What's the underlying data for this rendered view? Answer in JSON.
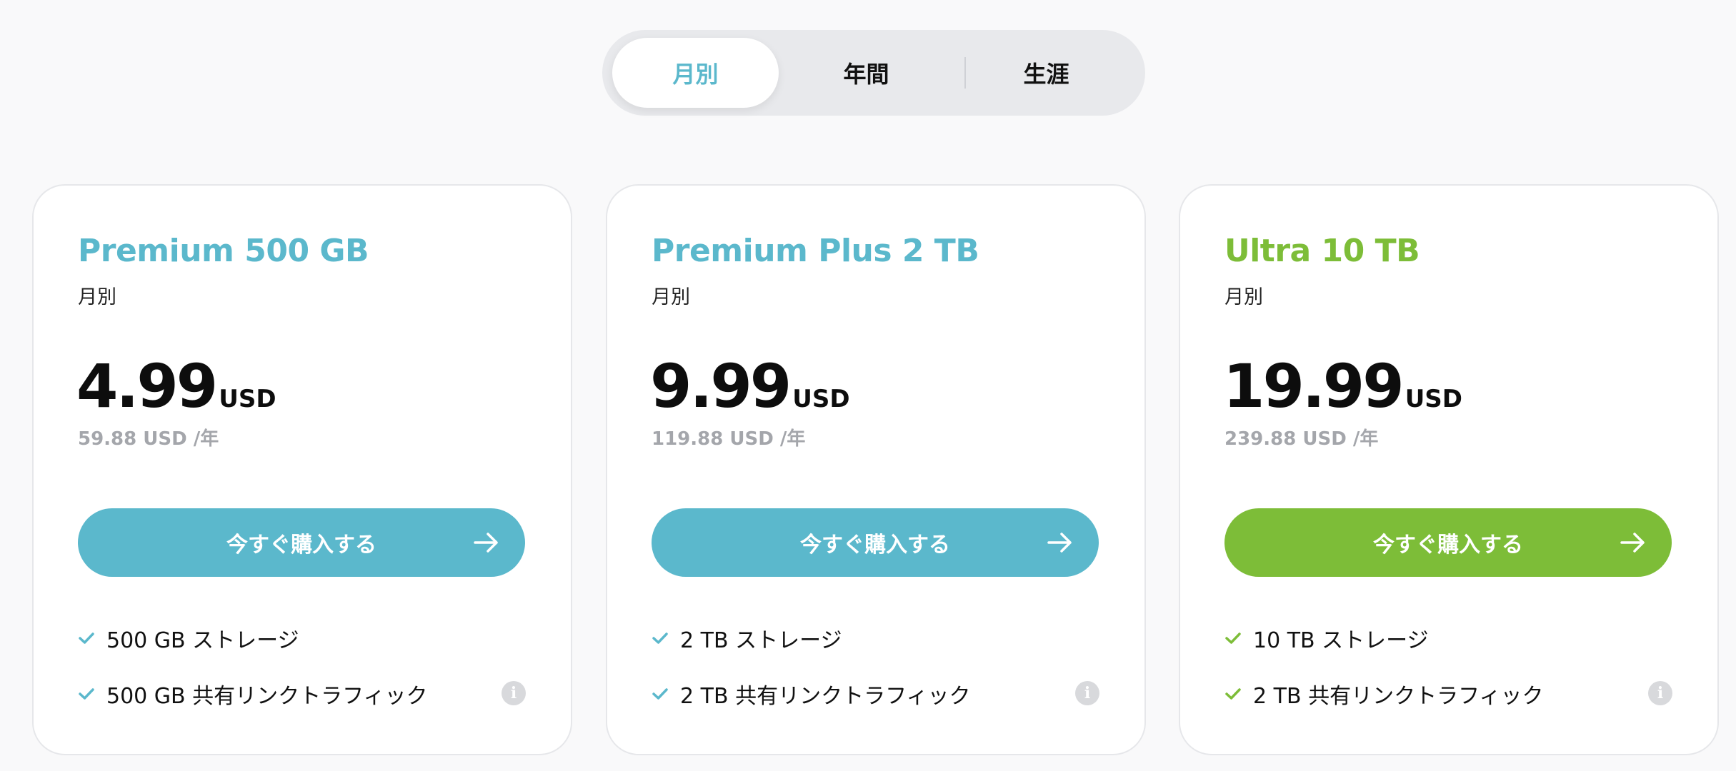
{
  "billing_toggle": {
    "options": [
      {
        "label": "月別",
        "active": true
      },
      {
        "label": "年間",
        "active": false
      },
      {
        "label": "生涯",
        "active": false
      }
    ]
  },
  "colors": {
    "teal": "#5bb8cc",
    "green": "#7dbd38",
    "page_background": "#f9f9fa"
  },
  "plans": [
    {
      "name": "Premium 500 GB",
      "period": "月別",
      "price": "4.99",
      "currency": "USD",
      "annual_price": "59.88 USD /年",
      "button_label": "今すぐ購入する",
      "accent": "#5bb8cc",
      "features": [
        {
          "text": "500 GB ストレージ"
        },
        {
          "text": "500 GB 共有リンクトラフィック"
        }
      ]
    },
    {
      "name": "Premium Plus 2 TB",
      "period": "月別",
      "price": "9.99",
      "currency": "USD",
      "annual_price": "119.88 USD /年",
      "button_label": "今すぐ購入する",
      "accent": "#5bb8cc",
      "features": [
        {
          "text": "2 TB ストレージ"
        },
        {
          "text": "2 TB 共有リンクトラフィック"
        }
      ]
    },
    {
      "name": "Ultra 10 TB",
      "period": "月別",
      "price": "19.99",
      "currency": "USD",
      "annual_price": "239.88 USD /年",
      "button_label": "今すぐ購入する",
      "accent": "#7dbd38",
      "features": [
        {
          "text": "10 TB ストレージ"
        },
        {
          "text": "2 TB 共有リンクトラフィック"
        }
      ]
    }
  ]
}
